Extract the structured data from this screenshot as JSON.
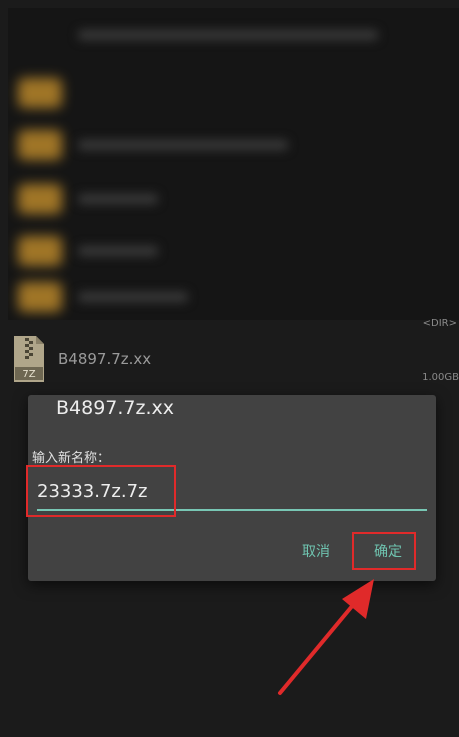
{
  "background_list": {
    "dir_tag": "<DIR>"
  },
  "file": {
    "name": "B4897.7z.xx",
    "size": "1.00GB",
    "icon": "zip-archive-icon",
    "icon_text": "7Z"
  },
  "dialog": {
    "title": "B4897.7z.xx",
    "prompt": "输入新名称：",
    "input_value": "23333.7z.7z",
    "cancel_label": "取消",
    "ok_label": "确定"
  },
  "colors": {
    "accent": "#6fc4b0",
    "highlight": "#e02a2a",
    "dialog_bg": "#424242"
  }
}
